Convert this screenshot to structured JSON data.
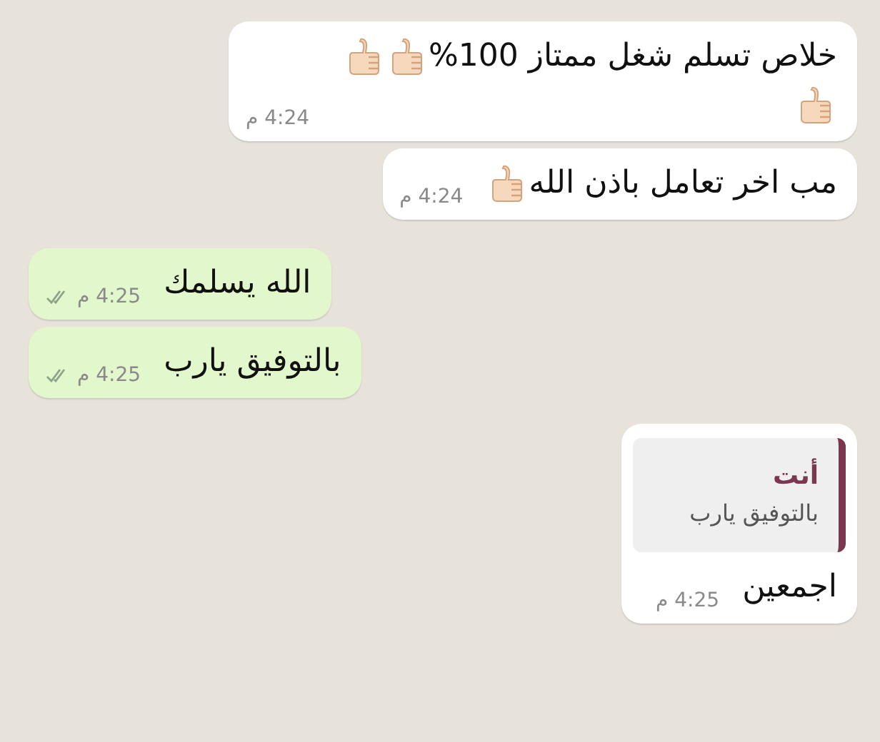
{
  "messages": [
    {
      "kind": "incoming",
      "text": "خلاص تسلم شغل ممتاز 100%",
      "emoji": [
        {
          "kind": "thumbs"
        },
        {
          "kind": "thumbs"
        },
        {
          "kind": "thumbs"
        }
      ],
      "time": "4:24 م"
    },
    {
      "kind": "incoming",
      "text": "مب اخر تعامل باذن الله",
      "emoji": [
        {
          "kind": "thumbs"
        }
      ],
      "time": "4:24 م"
    },
    {
      "kind": "outgoing",
      "text": "الله يسلمك",
      "time": "4:25 م",
      "read": false
    },
    {
      "kind": "outgoing",
      "text": "بالتوفيق يارب",
      "time": "4:25 م",
      "read": false
    },
    {
      "kind": "incoming",
      "quote": {
        "author": "أنت",
        "text": "بالتوفيق يارب"
      },
      "text": "اجمعين",
      "time": "4:25 م"
    }
  ]
}
